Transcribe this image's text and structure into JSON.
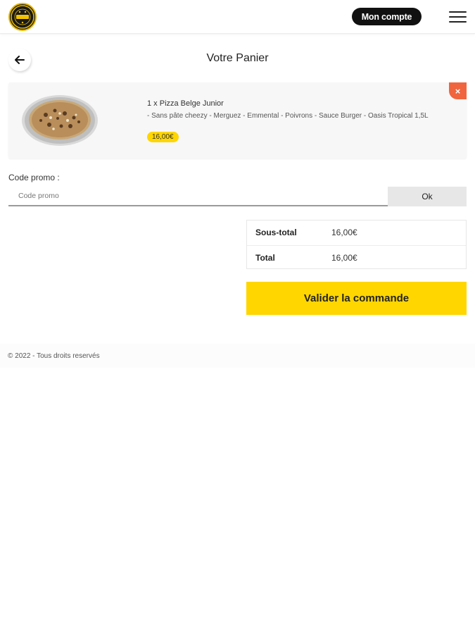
{
  "header": {
    "logo_icon": "pizza-logo-icon",
    "account_label": "Mon compte",
    "menu_icon": "hamburger-menu-icon"
  },
  "page": {
    "back_icon": "arrow-left-icon",
    "title": "Votre Panier"
  },
  "cart": {
    "items": [
      {
        "image_icon": "pizza-image",
        "title": "1 x Pizza Belge Junior",
        "description": "- Sans pâte cheezy - Merguez - Emmental - Poivrons - Sauce Burger - Oasis Tropical 1,5L",
        "price": "16,00€",
        "remove_icon": "close-icon",
        "remove_label": "×"
      }
    ]
  },
  "promo": {
    "label": "Code promo :",
    "placeholder": "Code promo",
    "value": "",
    "button_label": "Ok"
  },
  "totals": {
    "rows": [
      {
        "label": "Sous-total",
        "value": "16,00€"
      },
      {
        "label": "Total",
        "value": "16,00€"
      }
    ]
  },
  "checkout": {
    "button_label": "Valider la commande"
  },
  "footer": {
    "text": "© 2022 - Tous droits reservés"
  },
  "colors": {
    "accent_yellow": "#ffd600",
    "remove_red": "#f0653d",
    "dark": "#111111"
  }
}
